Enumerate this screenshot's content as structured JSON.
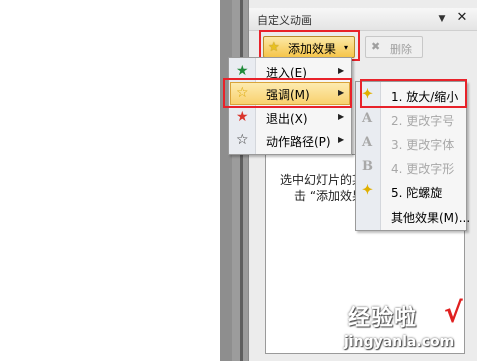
{
  "pane": {
    "title": "自定义动画",
    "menu_glyph": "▼",
    "close_glyph": "✕",
    "add_effect": {
      "label": "添加效果",
      "icon": "star-icon",
      "arrow": "▾"
    },
    "delete": {
      "label": "删除",
      "icon": "delete-icon"
    },
    "list_hint_line1": "选中幻灯片的某",
    "list_hint_line2": "击 “添加效果"
  },
  "effect_menu": {
    "items": [
      {
        "label": "进入(E)",
        "icon": "entrance-star-icon",
        "icon_glyph": "★",
        "color": "#1f8a3a",
        "arrow": "▶"
      },
      {
        "label": "强调(M)",
        "icon": "emphasis-star-icon",
        "icon_glyph": "☆",
        "color": "#d9a400",
        "arrow": "▶"
      },
      {
        "label": "退出(X)",
        "icon": "exit-star-icon",
        "icon_glyph": "★",
        "color": "#d9342b",
        "arrow": "▶"
      },
      {
        "label": "动作路径(P)",
        "icon": "motion-path-star-icon",
        "icon_glyph": "☆",
        "color": "#333333",
        "arrow": "▶"
      }
    ]
  },
  "emphasis_submenu": {
    "items": [
      {
        "label": "1. 放大/缩小",
        "icon": "grow-shrink-icon",
        "icon_glyph": "✦",
        "enabled": true
      },
      {
        "label": "2. 更改字号",
        "icon": "font-size-icon",
        "icon_glyph": "A",
        "enabled": false
      },
      {
        "label": "3. 更改字体",
        "icon": "font-icon",
        "icon_glyph": "A",
        "enabled": false
      },
      {
        "label": "4. 更改字形",
        "icon": "font-style-icon",
        "icon_glyph": "B",
        "enabled": false
      },
      {
        "label": "5. 陀螺旋",
        "icon": "spin-icon",
        "icon_glyph": "✦",
        "enabled": true
      },
      {
        "label": "其他效果(M)...",
        "icon": "",
        "icon_glyph": "",
        "enabled": true
      }
    ]
  },
  "watermark": {
    "text_cn": "经验啦",
    "check": "√",
    "text_en": "jingyanla.com"
  },
  "colors": {
    "highlight": "#e8222a",
    "accent": "#f6c54a"
  }
}
